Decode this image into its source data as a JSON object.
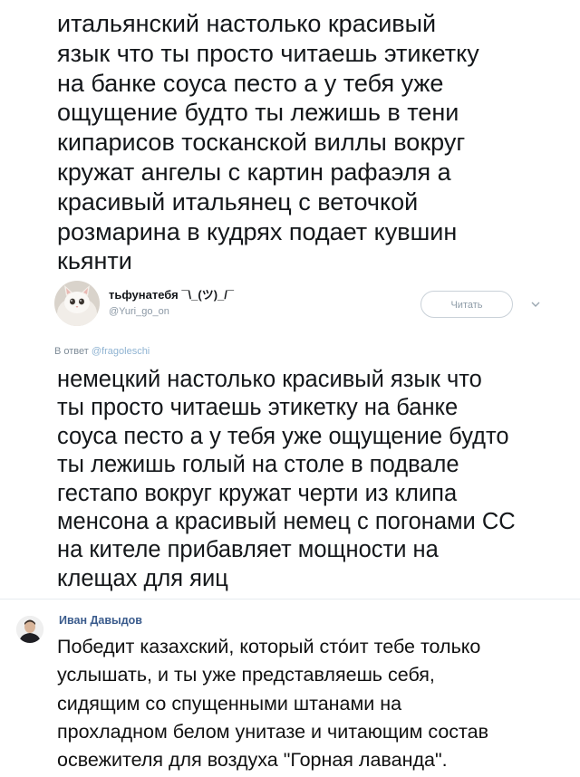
{
  "main_tweet": {
    "text": "итальянский настолько красивый\nязык что ты просто читаешь этикетку\nна банке соуса песто а у тебя уже\nощущение будто ты лежишь в тени\nкипарисов тосканской виллы вокруг\nкружат ангелы с картин рафаэля а\nкрасивый итальянец с веточкой\nрозмарина в кудрях подает кувшин\nкьянти"
  },
  "reply_tweet": {
    "avatar_icon": "cat-avatar",
    "display_name": "тьфунатебя ¯\\_(ツ)_/¯",
    "handle": "@Yuri_go_on",
    "follow_label": "Читать",
    "menu_icon": "chevron-down-icon",
    "reply_to_prefix": "В ответ",
    "reply_to_handle": "@fragoleschi",
    "text": "немецкий настолько красивый язык что\nты просто читаешь этикетку на банке\nсоуса песто а у тебя уже ощущение будто\nты лежишь голый на столе в подвале\nгестапо вокруг кружат черти из клипа\nменсона а красивый немец с погонами СС\nна кителе прибавляет мощности на\nклещах для яиц"
  },
  "comment": {
    "avatar_icon": "user-avatar",
    "author": "Иван Давыдов",
    "text": "Победит казахский, который сто́ит тебе только\nуслышать, и ты уже представляешь себя,\nсидящим со спущенными штанами на\nпрохладном белом унитазе и читающим состав\nосвежителя для воздуха \"Горная лаванда\"."
  },
  "colors": {
    "text": "#14171a",
    "handle": "#8b98a5",
    "link": "#3a5b8c",
    "mention": "#8fb3d2",
    "divider": "#e6ecf0"
  }
}
